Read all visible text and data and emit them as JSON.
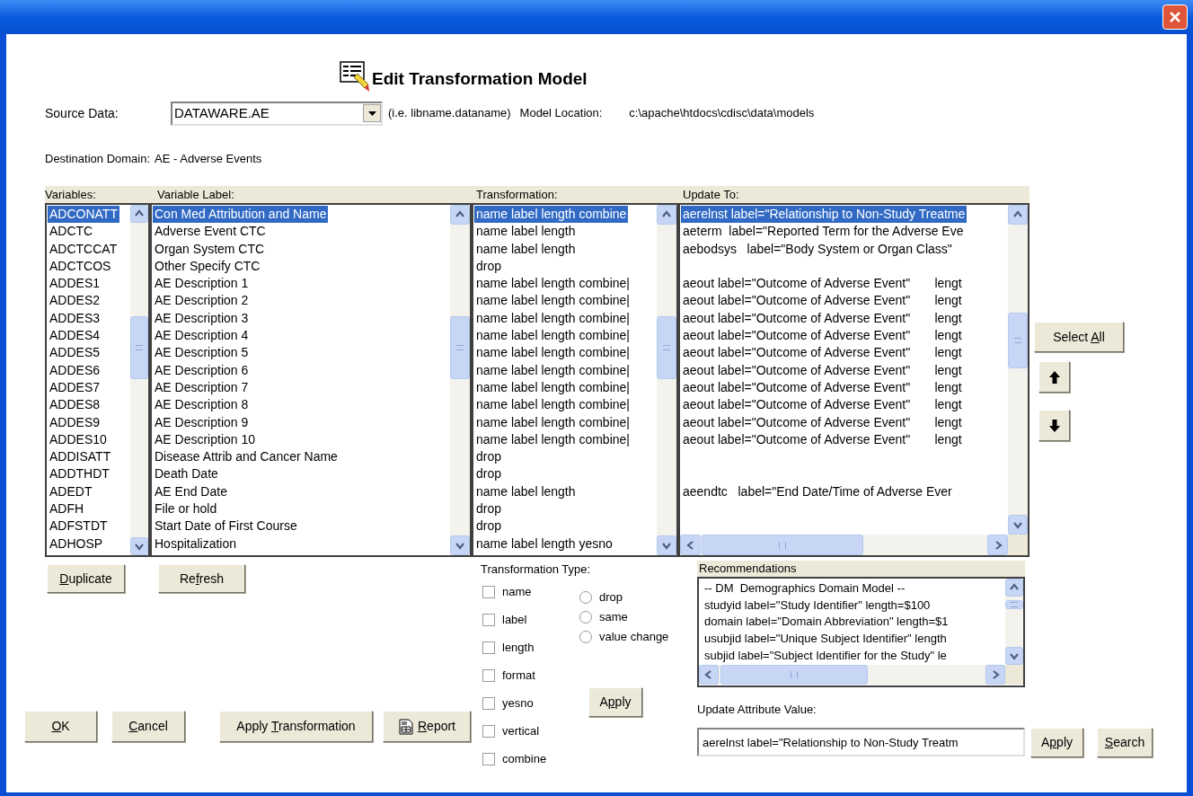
{
  "heading": "Edit Transformation Model",
  "source_data": {
    "label": "Source Data:",
    "value": "DATAWARE.AE",
    "hint": "(i.e. libname.dataname)"
  },
  "model_location": {
    "label": "Model Location:",
    "value": "c:\\apache\\htdocs\\cdisc\\data\\models"
  },
  "destination_domain": {
    "label": "Destination Domain:",
    "value": "AE - Adverse Events"
  },
  "columns": [
    "Variables:",
    "Variable Label:",
    "Transformation:",
    "Update To:"
  ],
  "rows": [
    {
      "variable": "ADCONATT",
      "label": "Con Med Attribution and Name",
      "transformation": "name label length combine",
      "update_to": "aerelnst label=\"Relationship to Non-Study Treatme",
      "selected": true
    },
    {
      "variable": "ADCTC",
      "label": "Adverse Event CTC",
      "transformation": "name label length",
      "update_to": "aeterm  label=\"Reported Term for the Adverse Eve",
      "selected": false
    },
    {
      "variable": "ADCTCCAT",
      "label": "Organ System CTC",
      "transformation": "name label length",
      "update_to": "aebodsys   label=\"Body System or Organ Class\"",
      "selected": false
    },
    {
      "variable": "ADCTCOS",
      "label": "Other Specify CTC",
      "transformation": "drop",
      "selected": false
    },
    {
      "variable": "ADDES1",
      "label": "AE Description 1",
      "transformation": "name label length combine|",
      "update_to": "aeout label=\"Outcome of Adverse Event\"       lengt",
      "selected": false
    },
    {
      "variable": "ADDES2",
      "label": "AE Description 2",
      "transformation": "name label length combine|",
      "update_to": "aeout label=\"Outcome of Adverse Event\"       lengt",
      "selected": false
    },
    {
      "variable": "ADDES3",
      "label": "AE Description 3",
      "transformation": "name label length combine|",
      "update_to": "aeout label=\"Outcome of Adverse Event\"       lengt",
      "selected": false
    },
    {
      "variable": "ADDES4",
      "label": "AE Description 4",
      "transformation": "name label length combine|",
      "update_to": "aeout label=\"Outcome of Adverse Event\"       lengt",
      "selected": false
    },
    {
      "variable": "ADDES5",
      "label": "AE Description 5",
      "transformation": "name label length combine|",
      "update_to": "aeout label=\"Outcome of Adverse Event\"       lengt",
      "selected": false
    },
    {
      "variable": "ADDES6",
      "label": "AE Description 6",
      "transformation": "name label length combine|",
      "update_to": "aeout label=\"Outcome of Adverse Event\"       lengt",
      "selected": false
    },
    {
      "variable": "ADDES7",
      "label": "AE Description 7",
      "transformation": "name label length combine|",
      "update_to": "aeout label=\"Outcome of Adverse Event\"       lengt",
      "selected": false
    },
    {
      "variable": "ADDES8",
      "label": "AE Description 8",
      "transformation": "name label length combine|",
      "update_to": "aeout label=\"Outcome of Adverse Event\"       lengt",
      "selected": false
    },
    {
      "variable": "ADDES9",
      "label": "AE Description 9",
      "transformation": "name label length combine|",
      "update_to": "aeout label=\"Outcome of Adverse Event\"       lengt",
      "selected": false
    },
    {
      "variable": "ADDES10",
      "label": "AE Description 10",
      "transformation": "name label length combine|",
      "update_to": "aeout label=\"Outcome of Adverse Event\"       lengt",
      "selected": false
    },
    {
      "variable": "ADDISATT",
      "label": "Disease Attrib and Cancer Name",
      "transformation": "drop",
      "selected": false
    },
    {
      "variable": "ADDTHDT",
      "label": "Death Date",
      "transformation": "drop",
      "selected": false
    },
    {
      "variable": "ADEDT",
      "label": "AE End Date",
      "transformation": "name label length",
      "update_to": "aeendtc   label=\"End Date/Time of Adverse Ever",
      "selected": false
    },
    {
      "variable": "ADFH",
      "label": "File or hold",
      "transformation": "drop",
      "selected": false
    },
    {
      "variable": "ADFSTDT",
      "label": "Start Date of First Course",
      "transformation": "drop",
      "selected": false
    },
    {
      "variable": "ADHOSP",
      "label": "Hospitalization",
      "transformation": "name label length yesno",
      "selected": false
    }
  ],
  "select_all": {
    "pre": "Select ",
    "key": "A",
    "post": "ll"
  },
  "duplicate": {
    "key": "D",
    "post": "uplicate"
  },
  "refresh": {
    "pre": "Re",
    "key": "f",
    "post": "resh"
  },
  "transformation_type": {
    "label": "Transformation Type:",
    "checkboxes": [
      {
        "label": "name",
        "checked": false
      },
      {
        "label": "label",
        "checked": false
      },
      {
        "label": "length",
        "checked": false
      },
      {
        "label": "format",
        "checked": false
      },
      {
        "label": "yesno",
        "checked": false
      },
      {
        "label": "vertical",
        "checked": false
      },
      {
        "label": "combine",
        "checked": false
      }
    ],
    "radios": [
      {
        "label": "drop",
        "selected": false
      },
      {
        "label": "same",
        "selected": false
      },
      {
        "label": "value change",
        "selected": false
      }
    ],
    "apply": {
      "pre": "A",
      "key": "p",
      "post": "ply"
    }
  },
  "recommendations": {
    "label": "Recommendations",
    "lines": [
      "-- DM  Demographics Domain Model --",
      "studyid label=\"Study Identifier\" length=$100",
      "domain label=\"Domain Abbreviation\" length=$1",
      "usubjid label=\"Unique Subject Identifier\" length",
      "subjid label=\"Subject Identifier for the Study\" le"
    ]
  },
  "update_attribute": {
    "label": "Update Attribute Value:",
    "value": "aerelnst label=\"Relationship to Non-Study Treatm",
    "apply": {
      "pre": "A",
      "key": "p",
      "post": "ply"
    },
    "search": {
      "key": "S",
      "post": "earch"
    }
  },
  "footer_buttons": [
    {
      "key": "O",
      "post": "K",
      "kind": "plain"
    },
    {
      "key": "C",
      "post": "ancel",
      "kind": "plain"
    },
    {
      "pre": "Apply ",
      "key": "T",
      "post": "ransformation",
      "kind": "plain"
    },
    {
      "key": "R",
      "post": "eport",
      "kind": "report"
    }
  ]
}
